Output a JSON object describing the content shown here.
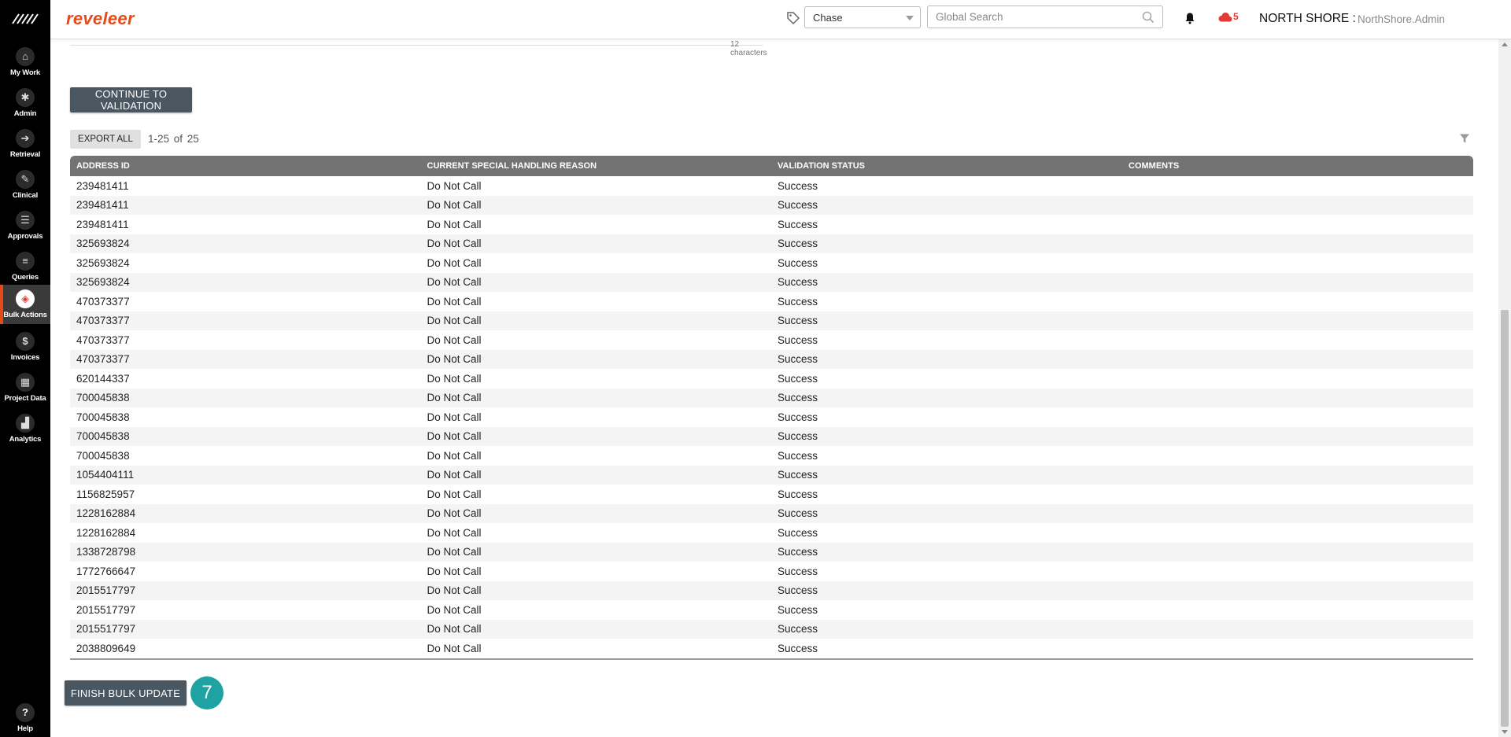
{
  "app": {
    "brand": "reveleer"
  },
  "sidebar": {
    "items": [
      {
        "label": "My Work",
        "icon": "home-icon",
        "glyph": "⌂"
      },
      {
        "label": "Admin",
        "icon": "gear-icon",
        "glyph": "✱"
      },
      {
        "label": "Retrieval",
        "icon": "arrow-icon",
        "glyph": "➔"
      },
      {
        "label": "Clinical",
        "icon": "clipboard-icon",
        "glyph": "✎"
      },
      {
        "label": "Approvals",
        "icon": "checklist-icon",
        "glyph": "☰"
      },
      {
        "label": "Queries",
        "icon": "list-icon",
        "glyph": "≡"
      },
      {
        "label": "Bulk Actions",
        "icon": "layers-icon",
        "glyph": "◈",
        "active": true
      },
      {
        "label": "Invoices",
        "icon": "dollar-icon",
        "glyph": "$"
      },
      {
        "label": "Project Data",
        "icon": "grid-icon",
        "glyph": "▦"
      },
      {
        "label": "Analytics",
        "icon": "chart-icon",
        "glyph": "▟"
      }
    ],
    "help": {
      "label": "Help",
      "glyph": "?"
    }
  },
  "header": {
    "chase_select": "Chase",
    "search_placeholder": "Global Search",
    "cloud_count": "5",
    "org": "NORTH SHORE :",
    "user": "NorthShore.Admin"
  },
  "colors": {
    "brand": "#e64a19",
    "button": "#4a5660",
    "badge": "#1fa2a2",
    "header_row": "#737373"
  },
  "main": {
    "char_count": "12 characters",
    "continue_button": "CONTINUE TO VALIDATION",
    "export_button": "EXPORT ALL",
    "pager": "1-25  of  25",
    "finish_button": "FINISH BULK UPDATE",
    "step_badge": "7"
  },
  "table": {
    "columns": [
      "ADDRESS ID",
      "CURRENT SPECIAL HANDLING REASON",
      "VALIDATION STATUS",
      "COMMENTS"
    ],
    "rows": [
      [
        "239481411",
        "Do Not Call",
        "Success",
        ""
      ],
      [
        "239481411",
        "Do Not Call",
        "Success",
        ""
      ],
      [
        "239481411",
        "Do Not Call",
        "Success",
        ""
      ],
      [
        "325693824",
        "Do Not Call",
        "Success",
        ""
      ],
      [
        "325693824",
        "Do Not Call",
        "Success",
        ""
      ],
      [
        "325693824",
        "Do Not Call",
        "Success",
        ""
      ],
      [
        "470373377",
        "Do Not Call",
        "Success",
        ""
      ],
      [
        "470373377",
        "Do Not Call",
        "Success",
        ""
      ],
      [
        "470373377",
        "Do Not Call",
        "Success",
        ""
      ],
      [
        "470373377",
        "Do Not Call",
        "Success",
        ""
      ],
      [
        "620144337",
        "Do Not Call",
        "Success",
        ""
      ],
      [
        "700045838",
        "Do Not Call",
        "Success",
        ""
      ],
      [
        "700045838",
        "Do Not Call",
        "Success",
        ""
      ],
      [
        "700045838",
        "Do Not Call",
        "Success",
        ""
      ],
      [
        "700045838",
        "Do Not Call",
        "Success",
        ""
      ],
      [
        "1054404111",
        "Do Not Call",
        "Success",
        ""
      ],
      [
        "1156825957",
        "Do Not Call",
        "Success",
        ""
      ],
      [
        "1228162884",
        "Do Not Call",
        "Success",
        ""
      ],
      [
        "1228162884",
        "Do Not Call",
        "Success",
        ""
      ],
      [
        "1338728798",
        "Do Not Call",
        "Success",
        ""
      ],
      [
        "1772766647",
        "Do Not Call",
        "Success",
        ""
      ],
      [
        "2015517797",
        "Do Not Call",
        "Success",
        ""
      ],
      [
        "2015517797",
        "Do Not Call",
        "Success",
        ""
      ],
      [
        "2015517797",
        "Do Not Call",
        "Success",
        ""
      ],
      [
        "2038809649",
        "Do Not Call",
        "Success",
        ""
      ]
    ]
  }
}
